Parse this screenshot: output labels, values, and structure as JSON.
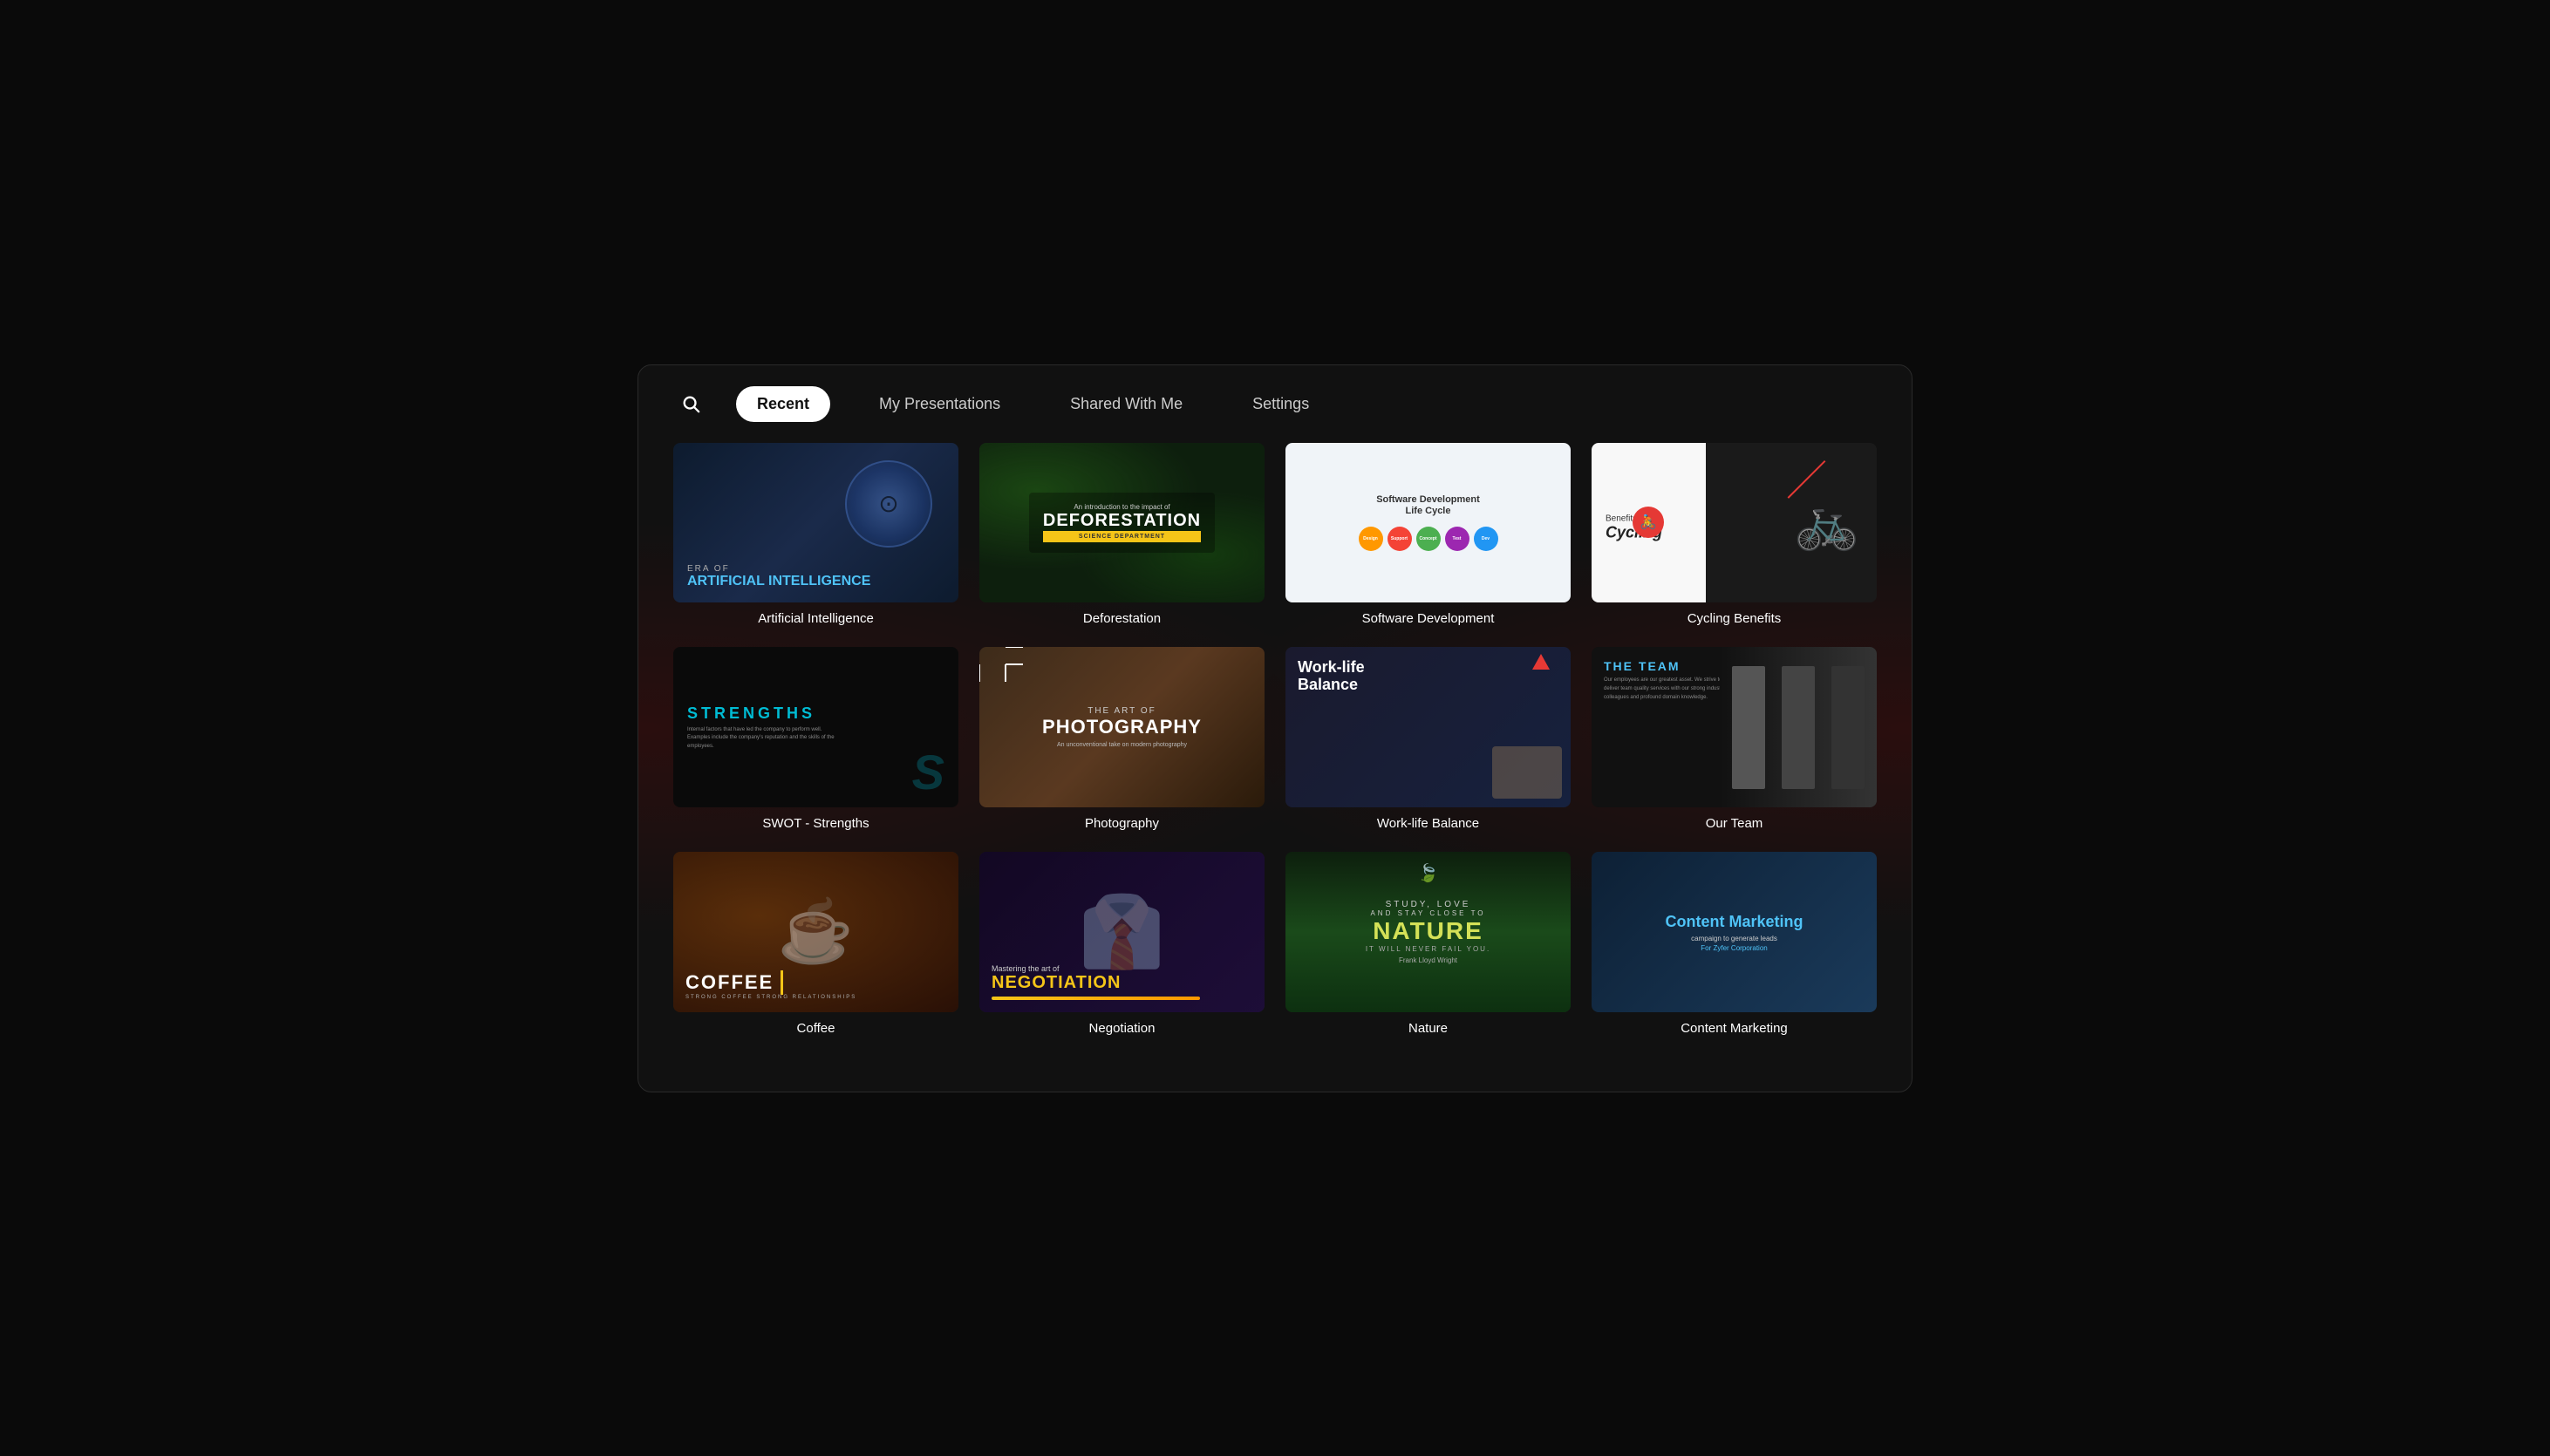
{
  "nav": {
    "tabs": [
      {
        "id": "recent",
        "label": "Recent",
        "active": true
      },
      {
        "id": "my-presentations",
        "label": "My Presentations",
        "active": false
      },
      {
        "id": "shared-with-me",
        "label": "Shared With Me",
        "active": false
      },
      {
        "id": "settings",
        "label": "Settings",
        "active": false
      }
    ],
    "search_placeholder": "Search..."
  },
  "presentations": [
    {
      "id": "ai",
      "title": "Artificial Intelligence",
      "thumb_type": "ai"
    },
    {
      "id": "deforestation",
      "title": "Deforestation",
      "thumb_type": "deforestation"
    },
    {
      "id": "software-dev",
      "title": "Software Development",
      "thumb_type": "software"
    },
    {
      "id": "cycling",
      "title": "Cycling Benefits",
      "thumb_type": "cycling"
    },
    {
      "id": "swot",
      "title": "SWOT - Strengths",
      "thumb_type": "swot"
    },
    {
      "id": "photography",
      "title": "Photography",
      "thumb_type": "photography"
    },
    {
      "id": "worklife",
      "title": "Work-life Balance",
      "thumb_type": "worklife"
    },
    {
      "id": "ourteam",
      "title": "Our Team",
      "thumb_type": "ourteam"
    },
    {
      "id": "coffee",
      "title": "Coffee",
      "thumb_type": "coffee"
    },
    {
      "id": "negotiation",
      "title": "Negotiation",
      "thumb_type": "negotiation"
    },
    {
      "id": "nature",
      "title": "Nature",
      "thumb_type": "nature"
    },
    {
      "id": "content-marketing",
      "title": "Content Marketing",
      "thumb_type": "content-marketing"
    }
  ],
  "thumbnails": {
    "ai": {
      "era": "ERA OF",
      "title": "ARTIFICIAL INTELLIGENCE"
    },
    "deforestation": {
      "intro": "An introduction to the impact of",
      "main": "DEFORESTATION",
      "badge": "SCIENCE DEPARTMENT"
    },
    "software": {
      "title1": "Software Development",
      "title2": "Life Cycle",
      "circles": [
        {
          "label": "Design &\nPrototyping",
          "color": "#ff9800"
        },
        {
          "label": "Support &\nMaintenance",
          "color": "#f44336"
        },
        {
          "label": "Concept &\nBrainstorming",
          "color": "#4caf50"
        },
        {
          "label": "Development &\nDeployment",
          "color": "#2196f3"
        },
        {
          "label": "Testing",
          "color": "#9c27b0"
        }
      ]
    },
    "cycling": {
      "benefits_of": "Benefits of",
      "cycling": "Cycling"
    },
    "swot": {
      "strengths": "STRENGTHS",
      "text": "Internal factors that have led the company to perform well. Examples include the company's reputation and the skills of the employees."
    },
    "photography": {
      "the_art_of": "THE ART OF",
      "photography": "PHOTOGRAPHY",
      "subtitle": "An unconventional take on modern photography"
    },
    "worklife": {
      "title": "Work-life\nBalance"
    },
    "ourteam": {
      "title": "THE TEAM",
      "subtitle": "Our employees are our greatest asset. We strive to deliver team quality services with our strong industry colleagues and profound domain knowledge."
    },
    "coffee": {
      "title": "COFFEE",
      "sub": "STRONG COFFEE\nSTRONG RELATIONSHIPS"
    },
    "negotiation": {
      "mastering": "Mastering the art of",
      "title": "NEGOTIATION"
    },
    "nature": {
      "study": "STUDY, LOVE",
      "stay": "AND STAY CLOSE TO",
      "title": "NATURE",
      "it_will": "IT WILL NEVER FAIL YOU.",
      "author": "Frank Lloyd Wright"
    },
    "content_marketing": {
      "title": "Content Marketing",
      "subtitle": "campaign to generate leads",
      "corp": "For Zyfer Corporation"
    }
  }
}
